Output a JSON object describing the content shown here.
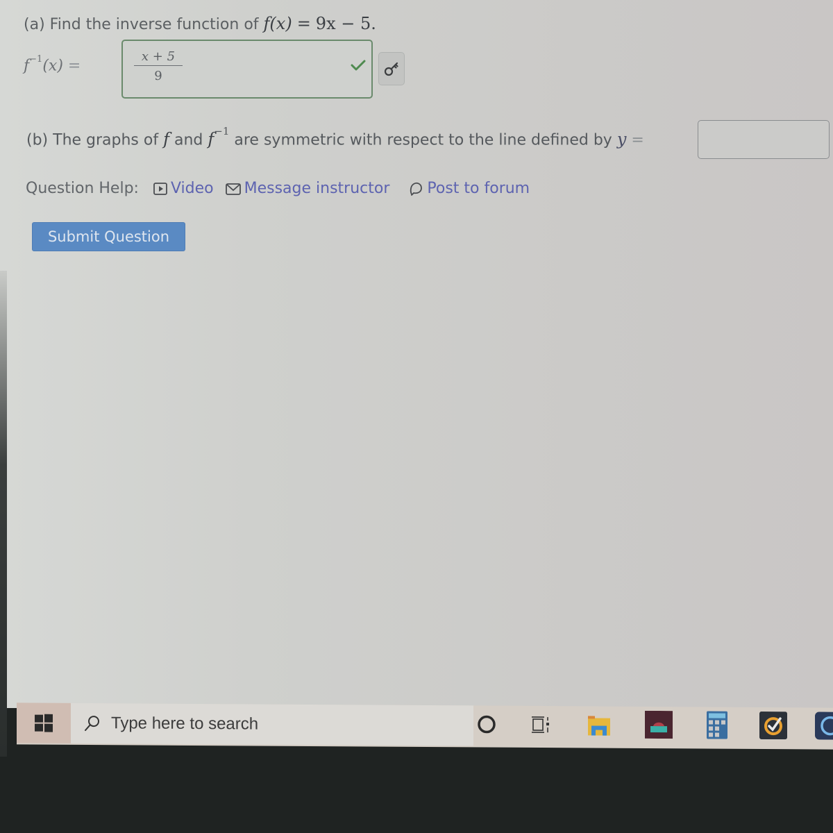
{
  "part_a": {
    "prefix": "(a) Find the inverse function of",
    "function": "f(x)",
    "equals": "=",
    "expression": "9x − 5."
  },
  "inverse_label": {
    "f": "f",
    "exponent": "−1",
    "arg": "(x)",
    "equals": "="
  },
  "answer_a": {
    "numerator": "x + 5",
    "denominator": "9",
    "status": "correct"
  },
  "part_b": {
    "prefix": "(b) The graphs of",
    "f1": "f",
    "and": "and",
    "f2": "f",
    "exponent": "−1",
    "suffix": "are symmetric with respect to the line defined by",
    "yvar": "y",
    "equals": "=",
    "input_value": ""
  },
  "question_help": {
    "label": "Question Help:",
    "links": [
      {
        "label": "Video",
        "icon": "video-icon"
      },
      {
        "label": "Message instructor",
        "icon": "mail-icon"
      },
      {
        "label": "Post to forum",
        "icon": "forum-icon"
      }
    ]
  },
  "submit": {
    "label": "Submit Question"
  },
  "taskbar": {
    "search_placeholder": "Type here to search",
    "icons": [
      "cortana-icon",
      "task-view-icon",
      "file-explorer-icon",
      "store-icon",
      "calculator-icon",
      "norton-icon",
      "app-icon"
    ]
  },
  "colors": {
    "link": "#5d63b0",
    "submit_bg": "#5a8ac3",
    "correct": "#4e8a4f"
  }
}
